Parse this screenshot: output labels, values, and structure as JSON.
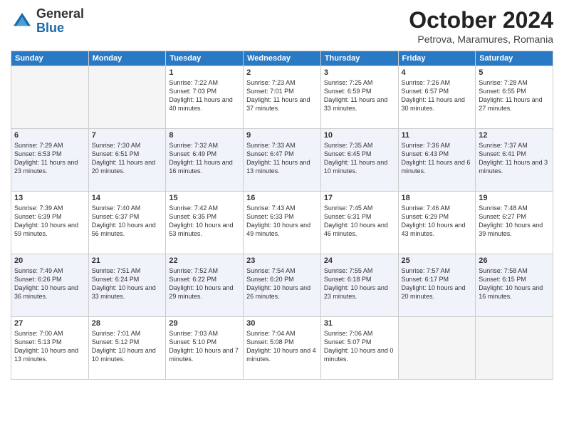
{
  "logo": {
    "general": "General",
    "blue": "Blue"
  },
  "title": "October 2024",
  "location": "Petrova, Maramures, Romania",
  "weekdays": [
    "Sunday",
    "Monday",
    "Tuesday",
    "Wednesday",
    "Thursday",
    "Friday",
    "Saturday"
  ],
  "weeks": [
    [
      {
        "day": "",
        "info": ""
      },
      {
        "day": "",
        "info": ""
      },
      {
        "day": "1",
        "info": "Sunrise: 7:22 AM\nSunset: 7:03 PM\nDaylight: 11 hours and 40 minutes."
      },
      {
        "day": "2",
        "info": "Sunrise: 7:23 AM\nSunset: 7:01 PM\nDaylight: 11 hours and 37 minutes."
      },
      {
        "day": "3",
        "info": "Sunrise: 7:25 AM\nSunset: 6:59 PM\nDaylight: 11 hours and 33 minutes."
      },
      {
        "day": "4",
        "info": "Sunrise: 7:26 AM\nSunset: 6:57 PM\nDaylight: 11 hours and 30 minutes."
      },
      {
        "day": "5",
        "info": "Sunrise: 7:28 AM\nSunset: 6:55 PM\nDaylight: 11 hours and 27 minutes."
      }
    ],
    [
      {
        "day": "6",
        "info": "Sunrise: 7:29 AM\nSunset: 6:53 PM\nDaylight: 11 hours and 23 minutes."
      },
      {
        "day": "7",
        "info": "Sunrise: 7:30 AM\nSunset: 6:51 PM\nDaylight: 11 hours and 20 minutes."
      },
      {
        "day": "8",
        "info": "Sunrise: 7:32 AM\nSunset: 6:49 PM\nDaylight: 11 hours and 16 minutes."
      },
      {
        "day": "9",
        "info": "Sunrise: 7:33 AM\nSunset: 6:47 PM\nDaylight: 11 hours and 13 minutes."
      },
      {
        "day": "10",
        "info": "Sunrise: 7:35 AM\nSunset: 6:45 PM\nDaylight: 11 hours and 10 minutes."
      },
      {
        "day": "11",
        "info": "Sunrise: 7:36 AM\nSunset: 6:43 PM\nDaylight: 11 hours and 6 minutes."
      },
      {
        "day": "12",
        "info": "Sunrise: 7:37 AM\nSunset: 6:41 PM\nDaylight: 11 hours and 3 minutes."
      }
    ],
    [
      {
        "day": "13",
        "info": "Sunrise: 7:39 AM\nSunset: 6:39 PM\nDaylight: 10 hours and 59 minutes."
      },
      {
        "day": "14",
        "info": "Sunrise: 7:40 AM\nSunset: 6:37 PM\nDaylight: 10 hours and 56 minutes."
      },
      {
        "day": "15",
        "info": "Sunrise: 7:42 AM\nSunset: 6:35 PM\nDaylight: 10 hours and 53 minutes."
      },
      {
        "day": "16",
        "info": "Sunrise: 7:43 AM\nSunset: 6:33 PM\nDaylight: 10 hours and 49 minutes."
      },
      {
        "day": "17",
        "info": "Sunrise: 7:45 AM\nSunset: 6:31 PM\nDaylight: 10 hours and 46 minutes."
      },
      {
        "day": "18",
        "info": "Sunrise: 7:46 AM\nSunset: 6:29 PM\nDaylight: 10 hours and 43 minutes."
      },
      {
        "day": "19",
        "info": "Sunrise: 7:48 AM\nSunset: 6:27 PM\nDaylight: 10 hours and 39 minutes."
      }
    ],
    [
      {
        "day": "20",
        "info": "Sunrise: 7:49 AM\nSunset: 6:26 PM\nDaylight: 10 hours and 36 minutes."
      },
      {
        "day": "21",
        "info": "Sunrise: 7:51 AM\nSunset: 6:24 PM\nDaylight: 10 hours and 33 minutes."
      },
      {
        "day": "22",
        "info": "Sunrise: 7:52 AM\nSunset: 6:22 PM\nDaylight: 10 hours and 29 minutes."
      },
      {
        "day": "23",
        "info": "Sunrise: 7:54 AM\nSunset: 6:20 PM\nDaylight: 10 hours and 26 minutes."
      },
      {
        "day": "24",
        "info": "Sunrise: 7:55 AM\nSunset: 6:18 PM\nDaylight: 10 hours and 23 minutes."
      },
      {
        "day": "25",
        "info": "Sunrise: 7:57 AM\nSunset: 6:17 PM\nDaylight: 10 hours and 20 minutes."
      },
      {
        "day": "26",
        "info": "Sunrise: 7:58 AM\nSunset: 6:15 PM\nDaylight: 10 hours and 16 minutes."
      }
    ],
    [
      {
        "day": "27",
        "info": "Sunrise: 7:00 AM\nSunset: 5:13 PM\nDaylight: 10 hours and 13 minutes."
      },
      {
        "day": "28",
        "info": "Sunrise: 7:01 AM\nSunset: 5:12 PM\nDaylight: 10 hours and 10 minutes."
      },
      {
        "day": "29",
        "info": "Sunrise: 7:03 AM\nSunset: 5:10 PM\nDaylight: 10 hours and 7 minutes."
      },
      {
        "day": "30",
        "info": "Sunrise: 7:04 AM\nSunset: 5:08 PM\nDaylight: 10 hours and 4 minutes."
      },
      {
        "day": "31",
        "info": "Sunrise: 7:06 AM\nSunset: 5:07 PM\nDaylight: 10 hours and 0 minutes."
      },
      {
        "day": "",
        "info": ""
      },
      {
        "day": "",
        "info": ""
      }
    ]
  ]
}
